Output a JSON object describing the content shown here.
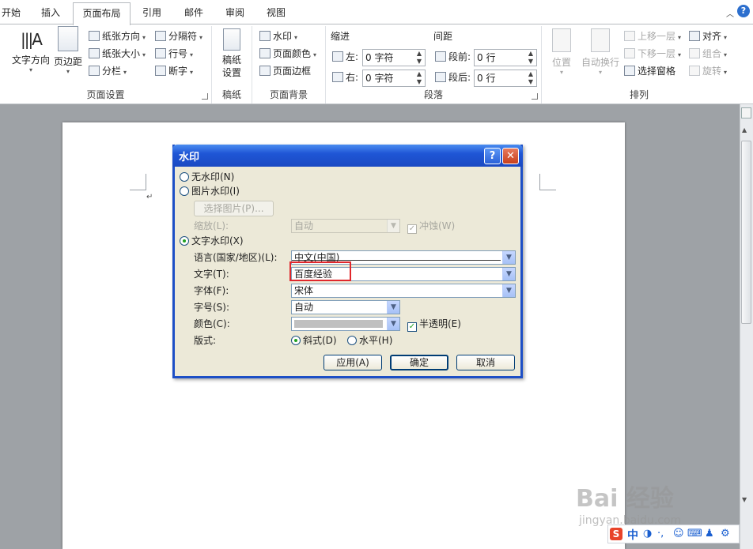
{
  "tabs": [
    "开始",
    "插入",
    "页面布局",
    "引用",
    "邮件",
    "审阅",
    "视图"
  ],
  "ribbon": {
    "page_setup": {
      "label": "页面设置",
      "text_direction": "文字方向",
      "margins": "页边距",
      "orientation": "纸张方向",
      "size": "纸张大小",
      "columns": "分栏",
      "breaks": "分隔符",
      "line_numbers": "行号",
      "hyphenation": "断字"
    },
    "draft": {
      "label": "稿纸",
      "setup": "稿纸设置"
    },
    "background": {
      "label": "页面背景",
      "watermark": "水印",
      "page_color": "页面颜色",
      "page_borders": "页面边框"
    },
    "paragraph": {
      "label": "段落",
      "indent": "缩进",
      "spacing": "间距",
      "left": "左:",
      "right": "右:",
      "before": "段前:",
      "after": "段后:",
      "left_val": "0 字符",
      "right_val": "0 字符",
      "before_val": "0 行",
      "after_val": "0 行"
    },
    "arrange": {
      "label": "排列",
      "position": "位置",
      "wrap": "自动换行",
      "bring_forward": "上移一层",
      "send_backward": "下移一层",
      "selection_pane": "选择窗格",
      "align": "对齐",
      "group": "组合",
      "rotate": "旋转"
    }
  },
  "dialog": {
    "title": "水印",
    "no_wm": "无水印(N)",
    "pic_wm": "图片水印(I)",
    "select_pic": "选择图片(P)...",
    "scale": "缩放(L):",
    "scale_val": "自动",
    "washout": "冲蚀(W)",
    "text_wm": "文字水印(X)",
    "language": "语言(国家/地区)(L):",
    "language_val": "中文(中国)",
    "text": "文字(T):",
    "text_val": "百度经验",
    "font": "字体(F):",
    "font_val": "宋体",
    "size": "字号(S):",
    "size_val": "自动",
    "color": "颜色(C):",
    "semitransparent": "半透明(E)",
    "layout": "版式:",
    "diagonal": "斜式(D)",
    "horizontal": "水平(H)",
    "apply": "应用(A)",
    "ok": "确定",
    "cancel": "取消"
  },
  "watermark": {
    "brand": "Bai 经验",
    "url": "jingyan.baidu.com"
  },
  "ime": {
    "lang": "中"
  },
  "colors": {
    "dialog_title": "#1f56d6",
    "highlight": "#e0282c",
    "check": "#21a121"
  }
}
